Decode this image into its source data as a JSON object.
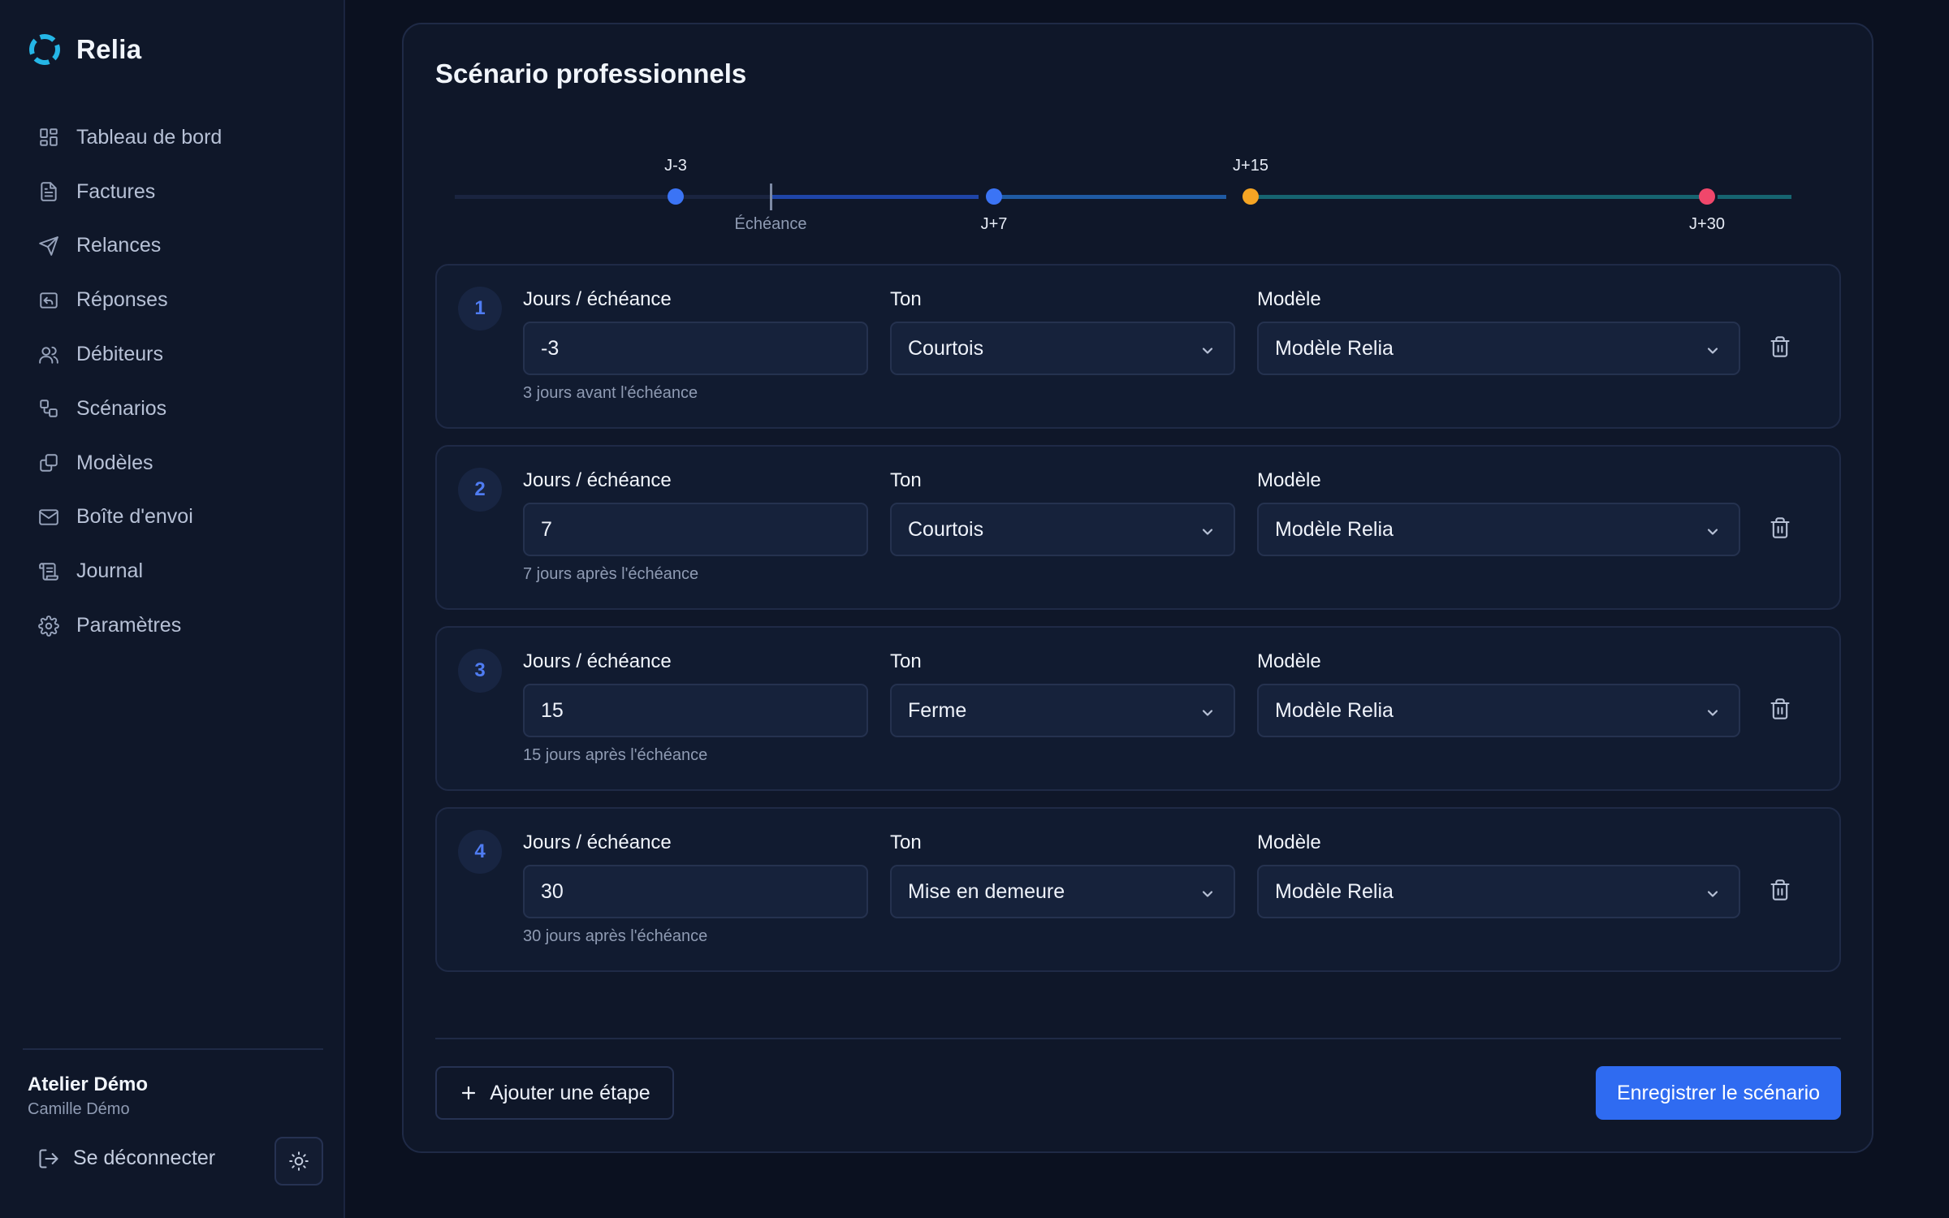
{
  "app": {
    "name": "Relia"
  },
  "sidebar": {
    "items": [
      {
        "label": "Tableau de bord",
        "icon": "dashboard-icon"
      },
      {
        "label": "Factures",
        "icon": "file-text-icon"
      },
      {
        "label": "Relances",
        "icon": "send-icon"
      },
      {
        "label": "Réponses",
        "icon": "reply-icon"
      },
      {
        "label": "Débiteurs",
        "icon": "users-icon"
      },
      {
        "label": "Scénarios",
        "icon": "workflow-icon"
      },
      {
        "label": "Modèles",
        "icon": "templates-icon"
      },
      {
        "label": "Boîte d'envoi",
        "icon": "mail-icon"
      },
      {
        "label": "Journal",
        "icon": "scroll-icon"
      },
      {
        "label": "Paramètres",
        "icon": "gear-icon"
      }
    ],
    "org_name": "Atelier Démo",
    "user_name": "Camille Démo",
    "logout_label": "Se déconnecter"
  },
  "scenario": {
    "title": "Scénario professionnels",
    "timeline": {
      "echeance_label": "Échéance",
      "markers": [
        {
          "label": "J-3",
          "day": -3,
          "color": "#3b74f5"
        },
        {
          "label": "J+7",
          "day": 7,
          "color": "#3b74f5"
        },
        {
          "label": "J+15",
          "day": 15,
          "color": "#f5a524"
        },
        {
          "label": "J+30",
          "day": 30,
          "color": "#f0476b"
        }
      ]
    },
    "field_labels": {
      "days": "Jours / échéance",
      "tone": "Ton",
      "template": "Modèle"
    },
    "steps": [
      {
        "number": "1",
        "days": "-3",
        "hint": "3 jours avant l'échéance",
        "tone": "Courtois",
        "template": "Modèle Relia"
      },
      {
        "number": "2",
        "days": "7",
        "hint": "7 jours après l'échéance",
        "tone": "Courtois",
        "template": "Modèle Relia"
      },
      {
        "number": "3",
        "days": "15",
        "hint": "15 jours après l'échéance",
        "tone": "Ferme",
        "template": "Modèle Relia"
      },
      {
        "number": "4",
        "days": "30",
        "hint": "30 jours après l'échéance",
        "tone": "Mise en demeure",
        "template": "Modèle Relia"
      }
    ],
    "add_step_label": "Ajouter une étape",
    "save_label": "Enregistrer le scénario"
  },
  "colors": {
    "accent": "#2f6bf1",
    "background": "#0b1120",
    "panel": "#0f1729"
  }
}
